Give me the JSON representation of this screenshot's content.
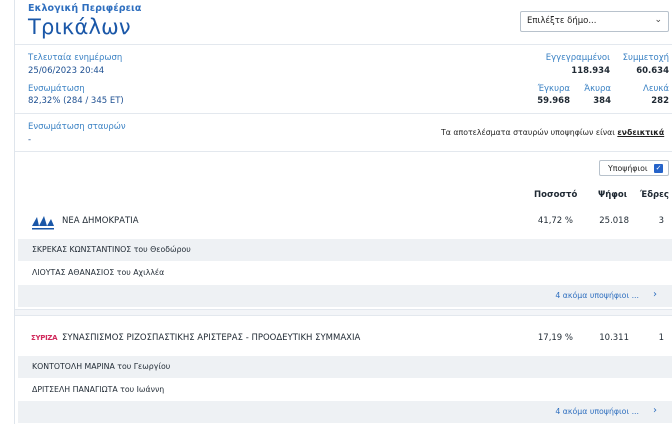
{
  "header": {
    "region_label": "Εκλογική Περιφέρεια",
    "region_title": "Τρικάλων",
    "municipality_select": "Επιλέξτε δήμο..."
  },
  "stats": {
    "last_update_label": "Τελευταία ενημέρωση",
    "last_update_value": "25/06/2023 20:44",
    "integration_label": "Ενσωμάτωση",
    "integration_value": "82,32% (284 / 345 ΕΤ)",
    "registered_label": "Εγγεγραμμένοι",
    "registered_value": "118.934",
    "turnout_label": "Συμμετοχή",
    "turnout_value": "60.634",
    "valid_label": "Έγκυρα",
    "valid_value": "59.968",
    "invalid_label": "Άκυρα",
    "invalid_value": "384",
    "blank_label": "Λευκά",
    "blank_value": "282",
    "cross_label": "Ενσωμάτωση σταυρών",
    "cross_value": "-",
    "notice_text": "Τα αποτελέσματα σταυρών υποψηφίων είναι ",
    "notice_link": "ενδεικτικά"
  },
  "toggle": {
    "label": "Υποψήφιοι",
    "checked": true
  },
  "columns": {
    "percent": "Ποσοστό",
    "votes": "Ψήφοι",
    "seats": "Έδρες"
  },
  "parties": [
    {
      "name": "ΝΕΑ ΔΗΜΟΚΡΑΤΙΑ",
      "percent": "41,72 %",
      "votes": "25.018",
      "seats": "3",
      "logo_color": "#1a57a8",
      "candidates": [
        "ΣΚΡΕΚΑΣ ΚΩΝΣΤΑΝΤΙΝΟΣ του Θεοδώρου",
        "ΛΙΟΥΤΑΣ ΑΘΑΝΑΣΙΟΣ του Αχιλλέα"
      ],
      "more_label": "4 ακόμα υποψήφιοι ..."
    },
    {
      "name": "ΣΥΝΑΣΠΙΣΜΟΣ ΡΙΖΟΣΠΑΣΤΙΚΗΣ ΑΡΙΣΤΕΡΑΣ - ΠΡΟΟΔΕΥΤΙΚΗ ΣΥΜΜΑΧΙΑ",
      "percent": "17,19 %",
      "votes": "10.311",
      "seats": "1",
      "logo_text": "ΣΥΡΙΖΑ",
      "logo_color": "#d12a5c",
      "candidates": [
        "ΚΟΝΤΟΤΟΛΗ ΜΑΡΙΝΑ του Γεωργίου",
        "ΔΡΙΤΣΕΛΗ ΠΑΝΑΓΙΩΤΑ του Ιωάννη"
      ],
      "more_label": "4 ακόμα υποψήφιοι ..."
    }
  ]
}
